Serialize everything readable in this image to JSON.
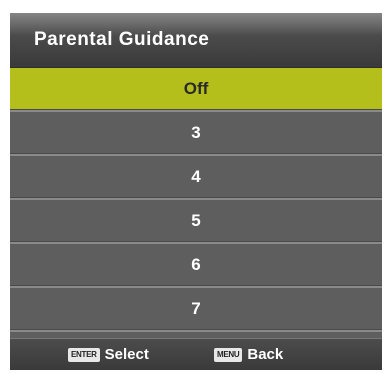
{
  "menu": {
    "title": "Parental Guidance",
    "selected_index": 0,
    "items": [
      "Off",
      "3",
      "4",
      "5",
      "6",
      "7"
    ]
  },
  "footer": {
    "enter_key": "ENTER",
    "enter_label": "Select",
    "menu_key": "MENU",
    "menu_label": "Back"
  },
  "colors": {
    "selected_bg": "#b5bf1c",
    "item_bg": "#5e5e5e",
    "title_bg": "#4a4a4a"
  }
}
